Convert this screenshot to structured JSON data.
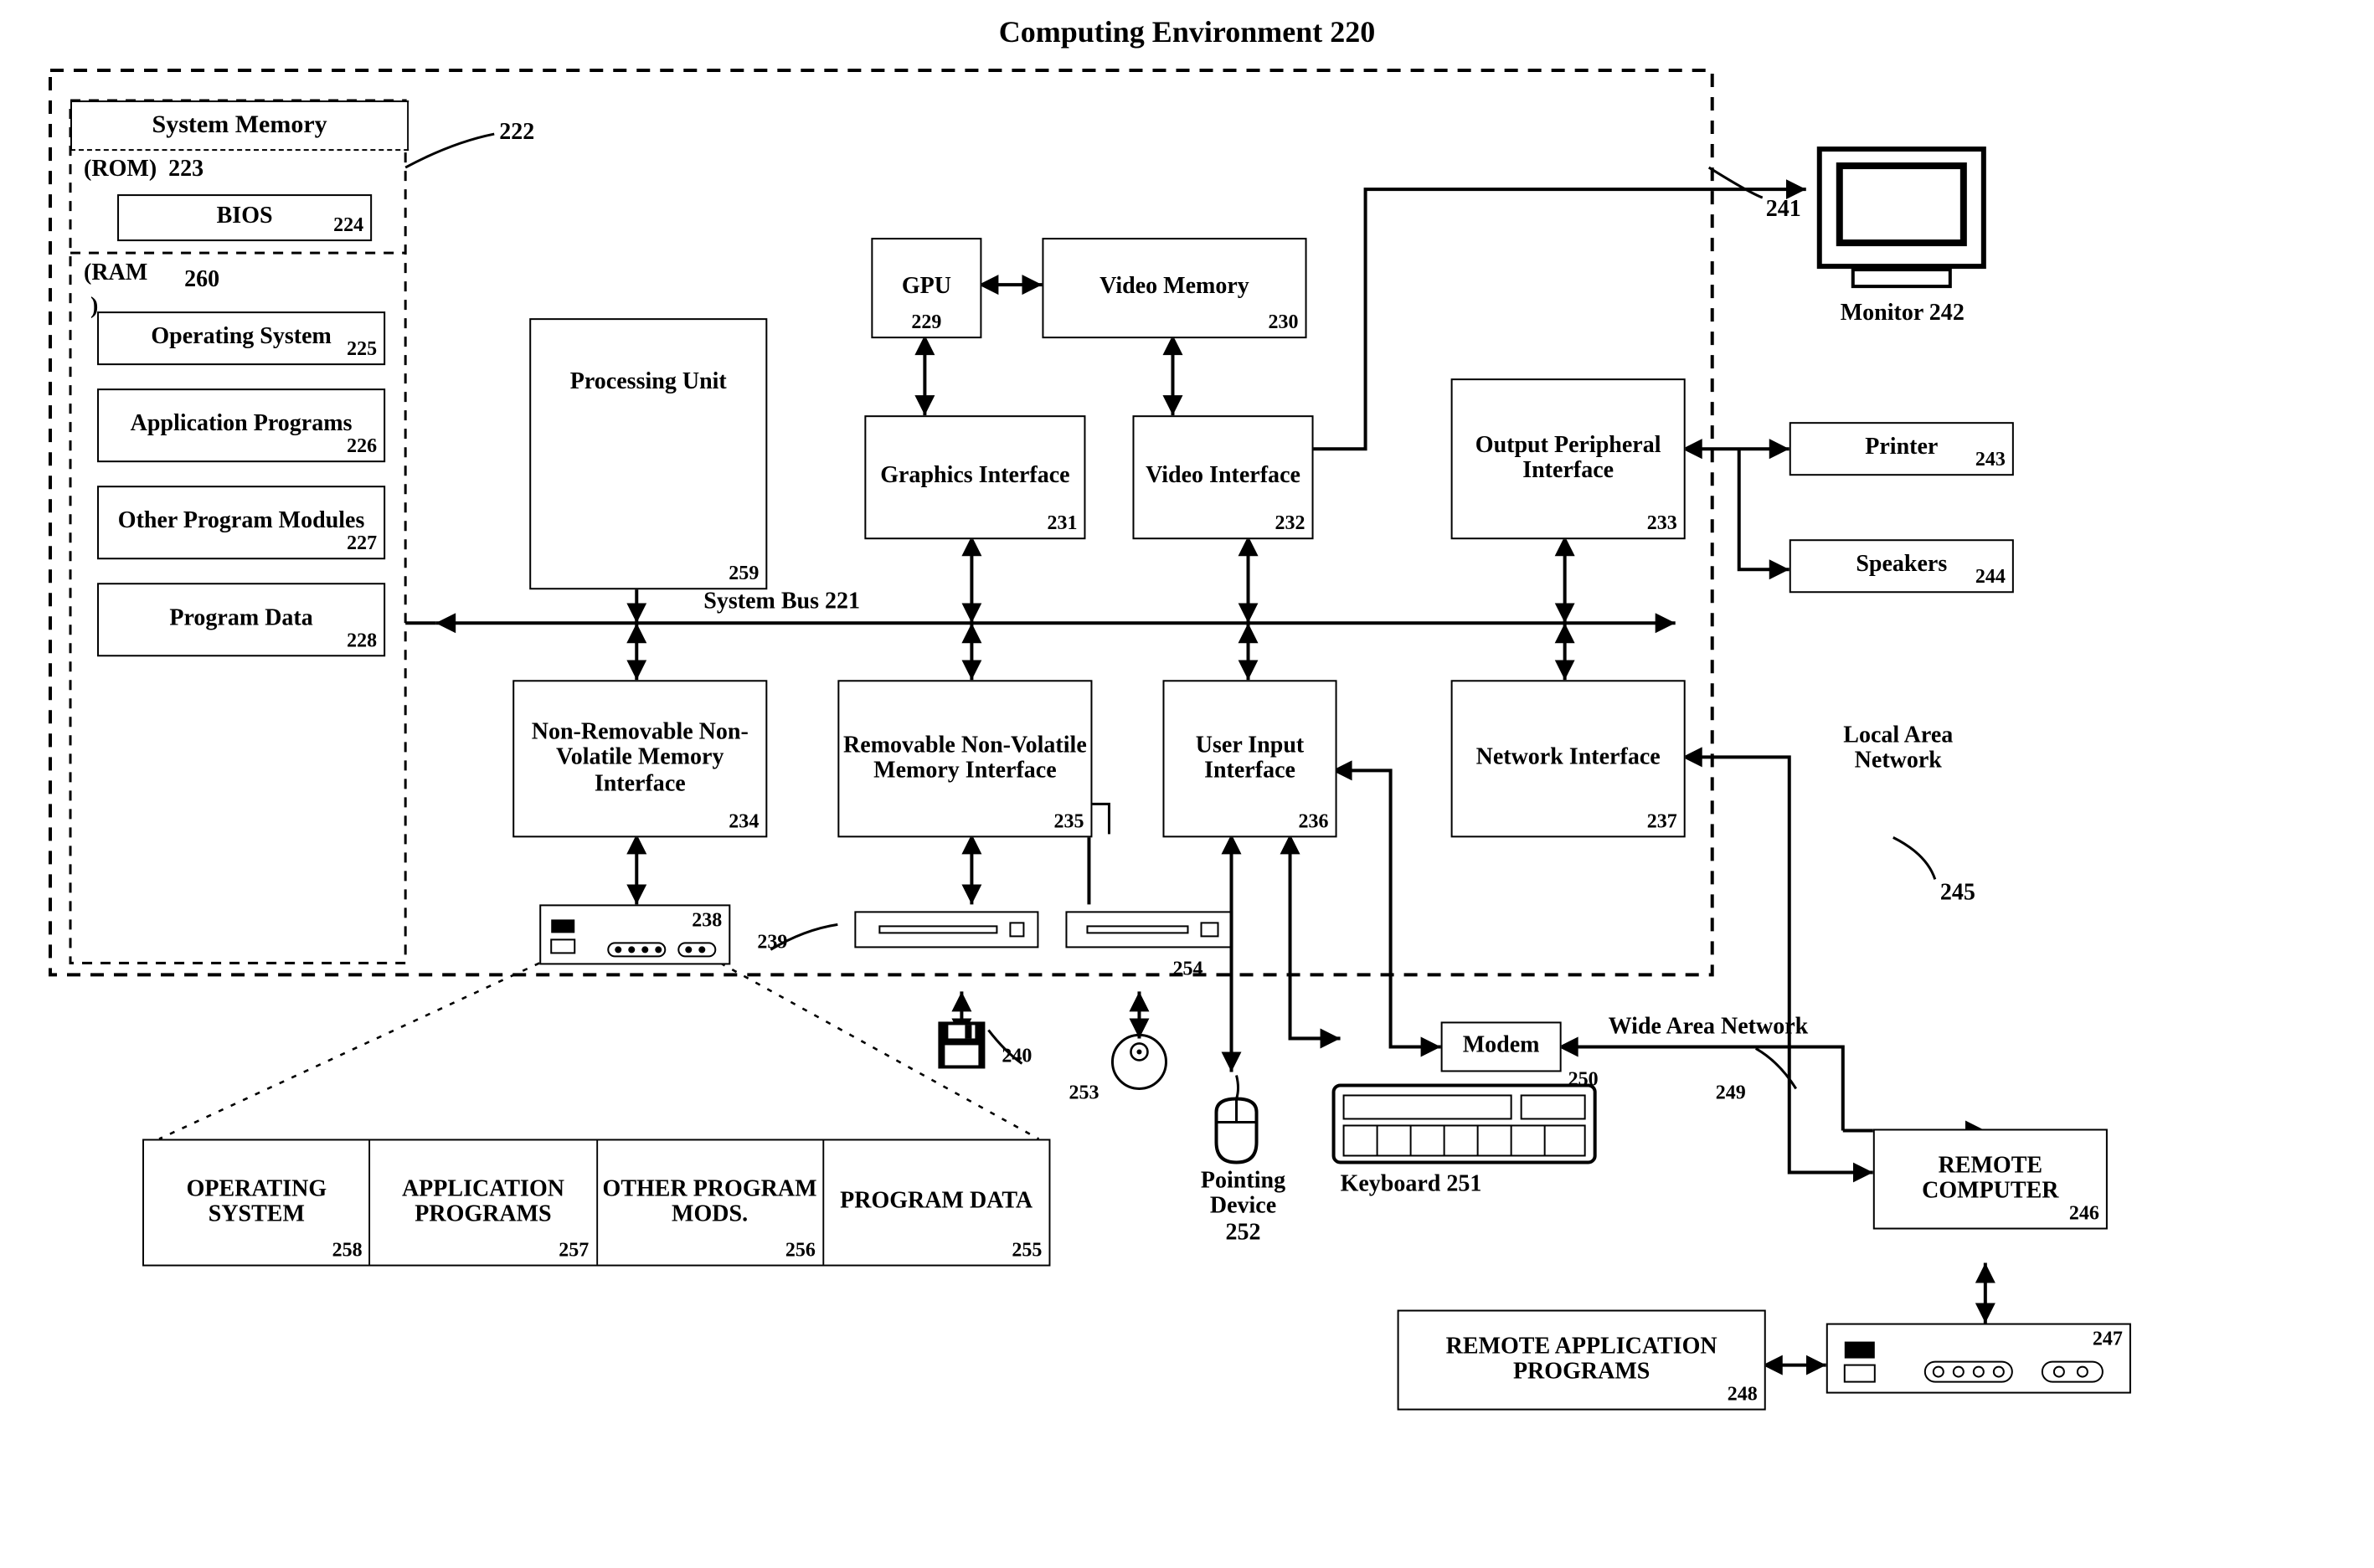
{
  "title": "Computing Environment 220",
  "sys_mem": "System Memory",
  "rom": "(ROM)",
  "rom_n": "223",
  "bios": "BIOS",
  "bios_n": "224",
  "ram": "(RAM",
  "ram_paren": ")",
  "ram_n": "260",
  "os": "Operating System",
  "os_n": "225",
  "apps": "Application Programs",
  "apps_n": "226",
  "mods": "Other Program Modules",
  "mods_n": "227",
  "pdata": "Program Data",
  "pdata_n": "228",
  "ref222": "222",
  "pu": "Processing Unit",
  "pu_n": "259",
  "gpu": "GPU",
  "gpu_n": "229",
  "vmem": "Video Memory",
  "vmem_n": "230",
  "gif": "Graphics Interface",
  "gif_n": "231",
  "vif": "Video Interface",
  "vif_n": "232",
  "opif": "Output Peripheral Interface",
  "opif_n": "233",
  "sysbus": "System Bus 221",
  "nvmi": "Non-Removable Non-Volatile Memory Interface",
  "nvmi_n": "234",
  "rvmi": "Removable Non-Volatile Memory Interface",
  "rvmi_n": "235",
  "uif": "User Input Interface",
  "uif_n": "236",
  "nif": "Network Interface",
  "nif_n": "237",
  "hdd_n": "238",
  "fdd_n": "239",
  "floppy_n": "240",
  "cdrom_n": "254",
  "cd_n": "253",
  "ref241": "241",
  "monitor": "Monitor 242",
  "printer": "Printer",
  "printer_n": "243",
  "speakers": "Speakers",
  "speakers_n": "244",
  "lan": "Local Area Network",
  "lan_n": "245",
  "wan": "Wide Area Network",
  "wan_n": "249",
  "modem": "Modem",
  "modem_n": "250",
  "kbd": "Keyboard 251",
  "ptr": "Pointing Device",
  "ptr_n": "252",
  "remote": "REMOTE COMPUTER",
  "remote_n": "246",
  "rhdd_n": "247",
  "rap": "REMOTE APPLICATION PROGRAMS",
  "rap_n": "248",
  "t_os": "OPERATING SYSTEM",
  "t_os_n": "258",
  "t_app": "APPLICATION PROGRAMS",
  "t_app_n": "257",
  "t_mod": "OTHER PROGRAM MODS.",
  "t_mod_n": "256",
  "t_pd": "PROGRAM DATA",
  "t_pd_n": "255"
}
